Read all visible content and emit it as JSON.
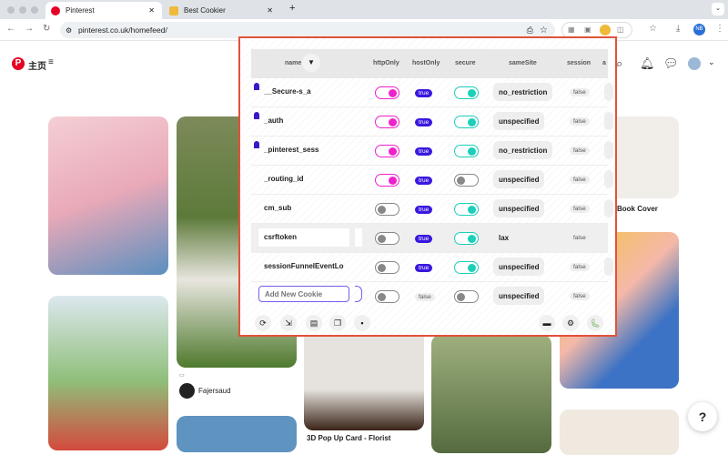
{
  "browser": {
    "tabs": [
      {
        "label": "Pinterest",
        "active": true
      },
      {
        "label": "Best Cookier",
        "active": false
      }
    ],
    "new_tab": "+",
    "url": "pinterest.co.uk/homefeed/",
    "profile": "NB"
  },
  "pinterest": {
    "home_label": "主页",
    "menu": "≡",
    "brand_color": "#e60023",
    "pins": [
      {
        "caption": "Fajersaud",
        "is_author": true
      },
      {
        "caption": "3D Pop Up Card - Florist"
      },
      {
        "caption": "Book Cover"
      }
    ],
    "help": "?"
  },
  "cookie_editor": {
    "columns": [
      "name",
      "httpOnly",
      "hostOnly",
      "secure",
      "sameSite",
      "session",
      "a"
    ],
    "rows": [
      {
        "name": "__Secure-s_a",
        "pinned": true,
        "httpOnly": true,
        "hostOnly": "true",
        "secure": true,
        "sameSite": "no_restriction",
        "session": "false"
      },
      {
        "name": "_auth",
        "pinned": true,
        "httpOnly": true,
        "hostOnly": "true",
        "secure": true,
        "sameSite": "unspecified",
        "session": "false"
      },
      {
        "name": "_pinterest_sess",
        "pinned": true,
        "httpOnly": true,
        "hostOnly": "true",
        "secure": true,
        "sameSite": "no_restriction",
        "session": "false"
      },
      {
        "name": "_routing_id",
        "pinned": false,
        "httpOnly": true,
        "hostOnly": "true",
        "secure": false,
        "sameSite": "unspecified",
        "session": "false"
      },
      {
        "name": "cm_sub",
        "pinned": false,
        "httpOnly": false,
        "hostOnly": "true",
        "secure": true,
        "sameSite": "unspecified",
        "session": "false"
      },
      {
        "name": "csrftoken",
        "pinned": false,
        "httpOnly": false,
        "hostOnly": "true",
        "secure": true,
        "sameSite": "lax",
        "session": "false",
        "selected": true
      },
      {
        "name": "sessionFunnelEventLo",
        "pinned": false,
        "httpOnly": false,
        "hostOnly": "true",
        "secure": true,
        "sameSite": "unspecified",
        "session": "false"
      }
    ],
    "new_row": {
      "placeholder": "Add New Cookie",
      "httpOnly": false,
      "hostOnly": "false",
      "secure": false,
      "sameSite": "unspecified",
      "session": "false"
    },
    "footer_icons": [
      "refresh-icon",
      "import-icon",
      "export-icon",
      "copy-icon",
      "delete-icon",
      "fullscreen-icon",
      "settings-icon",
      "bug-icon"
    ],
    "colors": {
      "httpOnly": "#ee22cc",
      "secure": "#1ccfb8",
      "badge": "#3a17e0",
      "border": "#e0533a"
    }
  }
}
